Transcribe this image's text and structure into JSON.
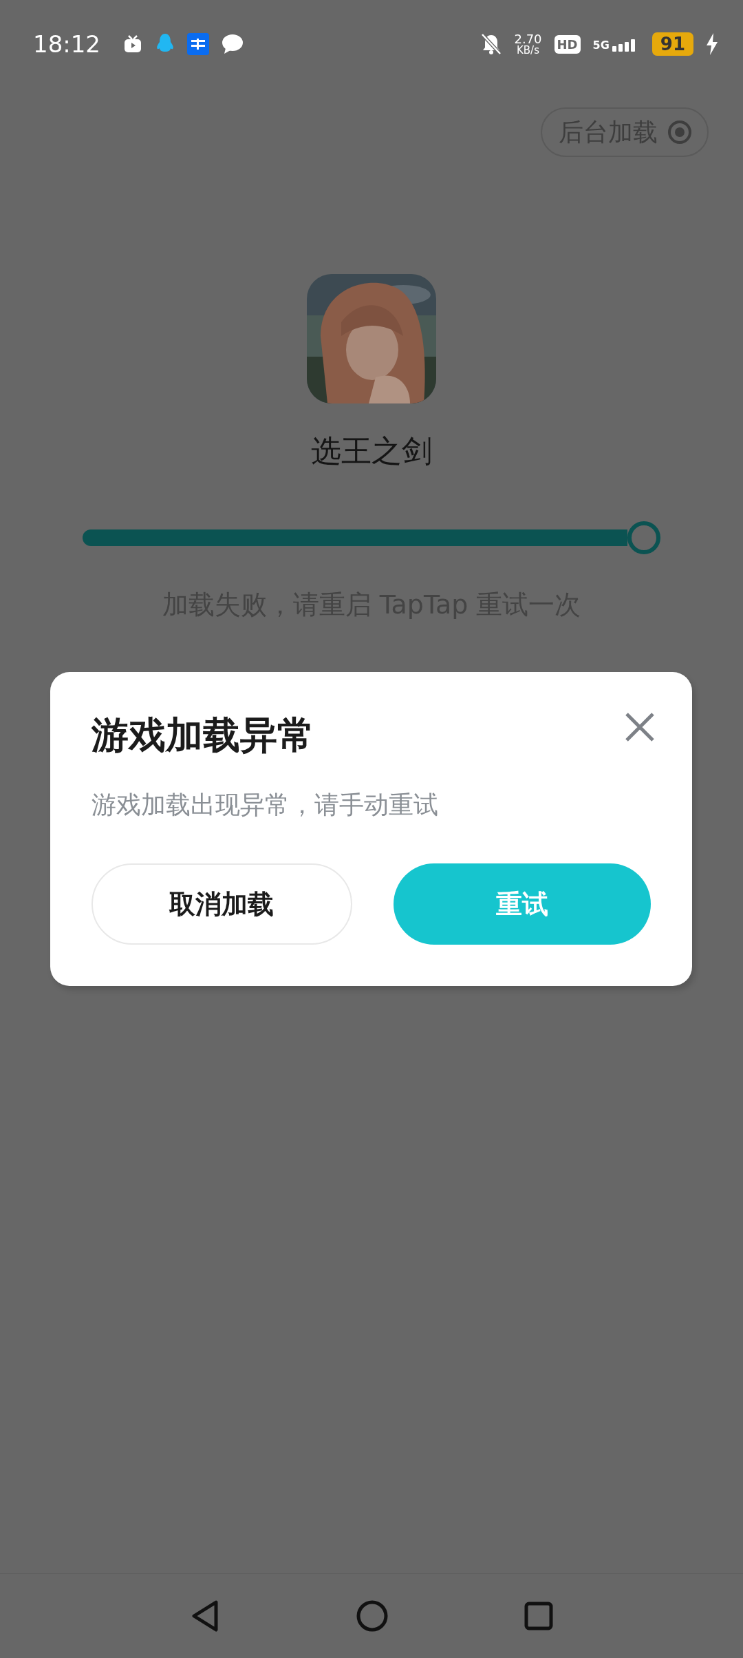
{
  "status_bar": {
    "time": "18:12",
    "net_speed": "2.70",
    "net_unit": "KB/s",
    "hd": "HD",
    "network": "5G",
    "battery": "91",
    "charging": true
  },
  "background_load_button": {
    "label": "后台加载"
  },
  "game": {
    "name": "选王之剑"
  },
  "progress": {
    "message": "加载失败，请重启 TapTap 重试一次"
  },
  "dialog": {
    "title": "游戏加载异常",
    "message": "游戏加载出现异常，请手动重试",
    "buttons": [
      {
        "label": "取消加载",
        "kind": "secondary"
      },
      {
        "label": "重试",
        "kind": "primary"
      }
    ]
  },
  "nav_bar": {
    "buttons": [
      {
        "kind": "back"
      },
      {
        "kind": "home"
      },
      {
        "kind": "recents"
      }
    ]
  }
}
